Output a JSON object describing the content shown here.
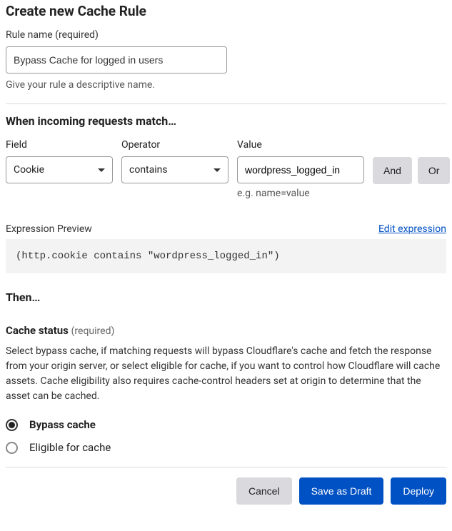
{
  "page_title": "Create new Cache Rule",
  "rule_name": {
    "label": "Rule name (required)",
    "value": "Bypass Cache for logged in users",
    "hint": "Give your rule a descriptive name."
  },
  "match_section": {
    "title": "When incoming requests match…",
    "field_label": "Field",
    "operator_label": "Operator",
    "value_label": "Value",
    "field_value": "Cookie",
    "operator_value": "contains",
    "value_value": "wordpress_logged_in",
    "value_hint": "e.g. name=value",
    "and_label": "And",
    "or_label": "Or"
  },
  "preview": {
    "label": "Expression Preview",
    "edit_link": "Edit expression",
    "expression": "(http.cookie contains \"wordpress_logged_in\")"
  },
  "then": {
    "title": "Then…"
  },
  "cache_status": {
    "label": "Cache status",
    "required": "(required)",
    "description": "Select bypass cache, if matching requests will bypass Cloudflare's cache and fetch the response from your origin server, or select eligible for cache, if you want to control how Cloudflare will cache assets. Cache eligibility also requires cache-control headers set at origin to determine that the asset can be cached.",
    "option_bypass": "Bypass cache",
    "option_eligible": "Eligible for cache"
  },
  "footer": {
    "cancel": "Cancel",
    "save_draft": "Save as Draft",
    "deploy": "Deploy"
  }
}
